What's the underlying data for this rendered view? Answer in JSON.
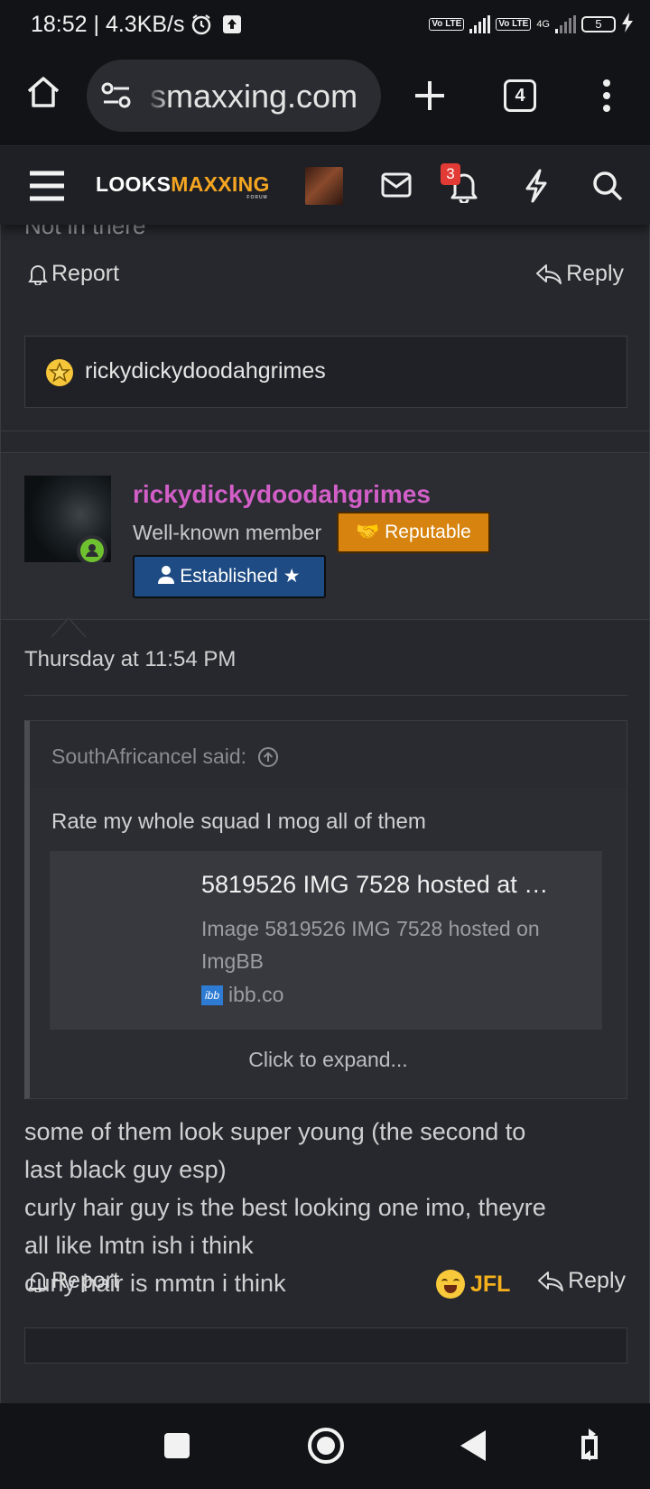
{
  "status_bar": {
    "time_speed": "18:52 | 4.3KB/s",
    "network_1": "Vo LTE",
    "network_2_type": "4G",
    "battery": "5"
  },
  "browser": {
    "url_visible": "smaxxing.com",
    "tab_count": "4"
  },
  "site_header": {
    "logo_part1": "LOOKS",
    "logo_part2": "MAXXING",
    "logo_sub": "FORUM",
    "alert_count": "3"
  },
  "prev_post": {
    "cut_text": "Not in there",
    "report_label": "Report",
    "reply_label": "Reply",
    "reaction_user": "rickydickydoodahgrimes"
  },
  "post": {
    "username": "rickydickydoodahgrimes",
    "user_title": "Well-known member",
    "banner_reputable": "Reputable",
    "banner_established": "Established ★",
    "date": "Thursday at 11:54 PM",
    "quote": {
      "said_by": "SouthAfricancel said:",
      "body": "Rate my whole squad I mog all of them",
      "embed_title": "5819526 IMG 7528 hosted at …",
      "embed_desc": "Image 5819526 IMG 7528 hosted on ImgBB",
      "embed_site": "ibb.co",
      "embed_site_icon": "ibb",
      "expand_label": "Click to expand..."
    },
    "message_lines": [
      "some of them look super young (the second to",
      "last black guy esp)",
      "curly hair guy is the best looking one imo, theyre",
      "all like lmtn ish i think",
      "curly hair is mmtn i think"
    ],
    "report_label": "Report",
    "reaction_label": "JFL",
    "reply_label": "Reply"
  },
  "colors": {
    "username": "#d25fc8",
    "reputable_banner": "#d6840f",
    "established_banner": "#1e4b83",
    "reaction": "#f5b11c",
    "logo_accent": "#f4a522"
  }
}
